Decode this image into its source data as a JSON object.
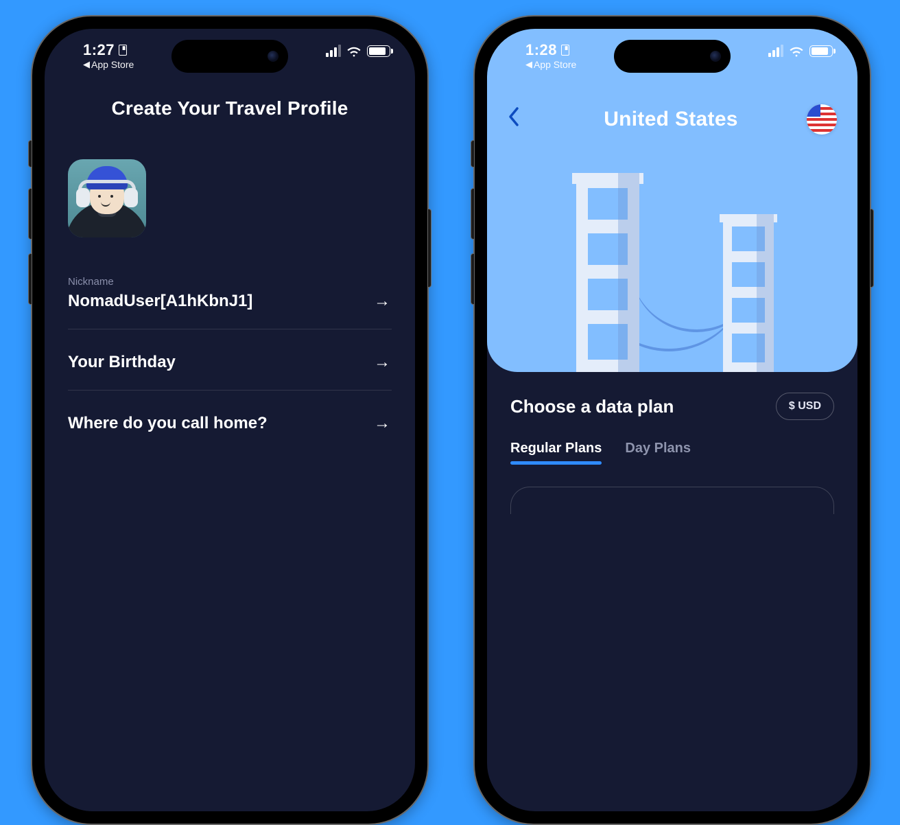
{
  "left": {
    "status": {
      "time": "1:27",
      "back_label": "App Store"
    },
    "title": "Create Your Travel Profile",
    "nickname_label": "Nickname",
    "nickname_value": "NomadUser[A1hKbnJ1]",
    "birthday_label": "Your Birthday",
    "home_label": "Where do you call home?"
  },
  "right": {
    "status": {
      "time": "1:28",
      "back_label": "App Store"
    },
    "country_title": "United States",
    "plans_title": "Choose a data plan",
    "currency_label": "$ USD",
    "tabs": {
      "regular": "Regular Plans",
      "day": "Day Plans"
    }
  }
}
